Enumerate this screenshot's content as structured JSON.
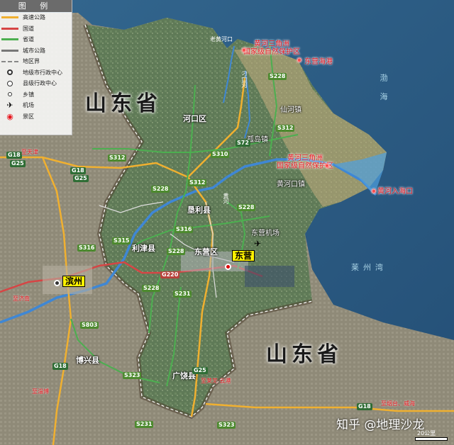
{
  "legend": {
    "title": "图 例",
    "items": [
      {
        "label": "高速公路",
        "icon": "expressway-line",
        "color": "#f0b030"
      },
      {
        "label": "国道",
        "icon": "national-road-line",
        "color": "#d64545"
      },
      {
        "label": "省道",
        "icon": "provincial-road-line",
        "color": "#4caf50"
      },
      {
        "label": "城市公路",
        "icon": "city-road-line",
        "color": "#777777"
      },
      {
        "label": "地区界",
        "icon": "boundary-dash-line",
        "color": "#888888"
      },
      {
        "label": "地级市行政中心",
        "icon": "prefecture-center-icon"
      },
      {
        "label": "县级行政中心",
        "icon": "county-center-icon"
      },
      {
        "label": "乡镇",
        "icon": "township-icon"
      },
      {
        "label": "机场",
        "icon": "airport-icon"
      },
      {
        "label": "景区",
        "icon": "scenic-spot-icon",
        "color": "#e8151d"
      }
    ]
  },
  "provinces": {
    "north": "山东省",
    "south": "山东省"
  },
  "seas": {
    "bohai": "渤 海",
    "laizhou": "莱州湾"
  },
  "cities": {
    "dongying": "东营",
    "binzhou": "滨州",
    "hekou": "河口区",
    "kenli": "垦利县",
    "lijin": "利津县",
    "dongyingqu": "东营区",
    "guangrao": "广饶县",
    "boxing": "博兴县",
    "xianhe": "仙河镇",
    "gudao": "孤岛镇",
    "huanghekou": "黄河口镇",
    "airport": "东营机场"
  },
  "scenic": {
    "delta_north": "黄河三角洲\n国家级自然保护区",
    "delta_south": "黄河三角洲\n国家级自然保护区",
    "dongying_port": "东营海港",
    "river_mouth": "黄河入海口"
  },
  "rivers": {
    "old_mouth": "老黄河口",
    "ditch": "刁口河",
    "huanghe": "黄河"
  },
  "roads": {
    "g18_w": "G18",
    "g25_w": "G25",
    "s312_w": "S312",
    "g18_c": "G18",
    "g25_c": "G25",
    "s316": "S316",
    "s315": "S315",
    "s316_c": "S316",
    "s228_a": "S228",
    "s228_b": "S228",
    "g220": "G220",
    "s231": "S231",
    "s228_c": "S228",
    "s803": "S803",
    "g18_s": "G18",
    "s323_a": "S323",
    "g25_s": "G25",
    "s231_b": "S231",
    "s323_b": "S323",
    "s310": "S310",
    "s72": "S72",
    "s312": "S312",
    "s312_e": "S312",
    "s228_e": "S228",
    "g18_e": "G18",
    "s228_n": "S228",
    "s228_m": "S228"
  },
  "directions": {
    "to_tianjin": "至天津",
    "to_jinan": "至济南",
    "to_zibo": "至淄博",
    "to_laiwu": "至莱芜·云港",
    "to_yantai": "至烟台、威海"
  },
  "scale": "20公里",
  "watermark": "知乎 @地理沙龙"
}
